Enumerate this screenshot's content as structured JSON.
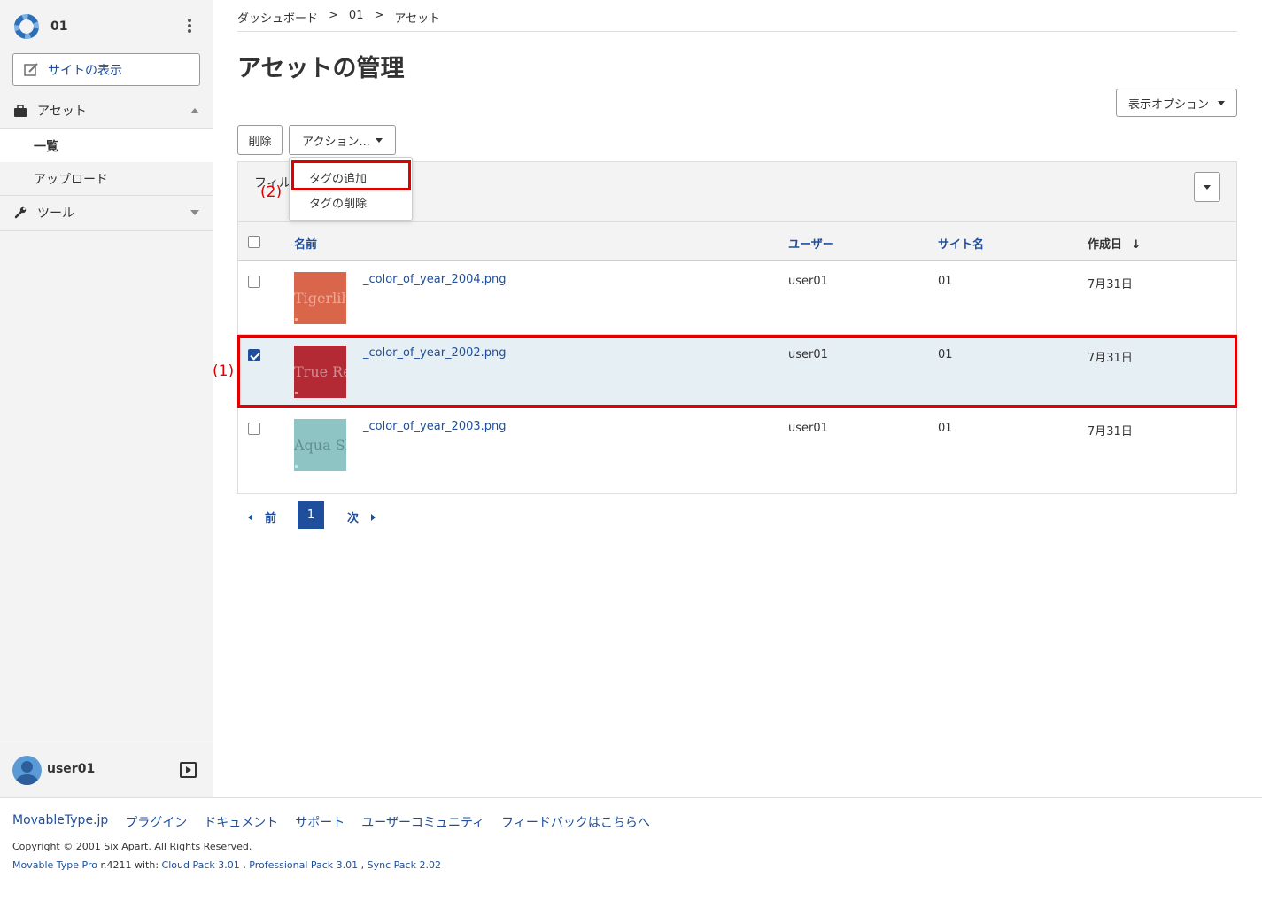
{
  "site": {
    "name": "01",
    "view_site_label": "サイトの表示"
  },
  "sidebar": {
    "assets": {
      "label": "アセット",
      "items": [
        {
          "label": "一覧"
        },
        {
          "label": "アップロード"
        }
      ]
    },
    "tools": {
      "label": "ツール"
    }
  },
  "user": {
    "name": "user01"
  },
  "breadcrumb": {
    "items": [
      "ダッシュボード",
      "01",
      "アセット"
    ],
    "separator": ">"
  },
  "page": {
    "title": "アセットの管理"
  },
  "toolbar": {
    "delete_label": "削除",
    "actions_label": "アクション...",
    "display_options_label": "表示オプション"
  },
  "actions_menu": {
    "items": [
      "タグの追加",
      "タグの削除"
    ]
  },
  "filter": {
    "label": "フィル"
  },
  "table": {
    "columns": {
      "name": "名前",
      "user": "ユーザー",
      "site": "サイト名",
      "created": "作成日"
    },
    "sort_indicator": "↓",
    "rows": [
      {
        "file": "_color_of_year_2004.png",
        "user": "user01",
        "site": "01",
        "created": "7月31日",
        "thumb_text": "Tigerlily",
        "thumb_color": "#d9654a",
        "checked": false
      },
      {
        "file": "_color_of_year_2002.png",
        "user": "user01",
        "site": "01",
        "created": "7月31日",
        "thumb_text": "True Red",
        "thumb_color": "#b32a35",
        "checked": true
      },
      {
        "file": "_color_of_year_2003.png",
        "user": "user01",
        "site": "01",
        "created": "7月31日",
        "thumb_text": "Aqua Sky",
        "thumb_color": "#8fc4c4",
        "checked": false
      }
    ]
  },
  "pagination": {
    "prev": "前",
    "current": "1",
    "next": "次"
  },
  "annotations": {
    "row_label": "(1)",
    "menu_label": "(2)",
    "color": "#e00000"
  },
  "footer": {
    "links": [
      "MovableType.jp",
      "プラグイン",
      "ドキュメント",
      "サポート",
      "ユーザーコミュニティ",
      "フィードバックはこちらへ"
    ],
    "copyright": "Copyright © 2001 Six Apart. All Rights Reserved.",
    "version": {
      "product": "Movable Type Pro",
      "build": " r.4211 with: ",
      "packs": [
        "Cloud Pack 3.01",
        "Professional Pack 3.01",
        "Sync Pack 2.02"
      ],
      "separator": " , "
    }
  },
  "colors": {
    "accent": "#1f4f9c",
    "selected_row": "#e6f0f4",
    "sidebar_bg": "#f3f3f3"
  }
}
